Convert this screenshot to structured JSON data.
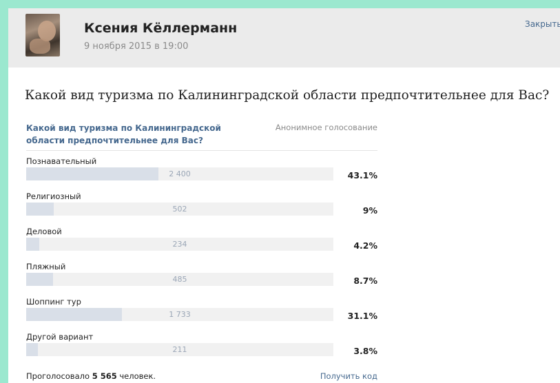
{
  "post": {
    "author": "Ксения Кёллерманн",
    "date": "9 ноября 2015 в 19:00",
    "close_label": "Закрыть",
    "question": "Какой вид туризма по Калининградской области предпочтительнее для Вас?"
  },
  "poll": {
    "title": "Какой вид туризма по Калининградской области предпочтительнее для Вас?",
    "type_label": "Анонимное голосование",
    "options": [
      {
        "label": "Познавательный",
        "votes": "2 400",
        "percent": "43.1%",
        "share": 0.431
      },
      {
        "label": "Религиозный",
        "votes": "502",
        "percent": "9%",
        "share": 0.09
      },
      {
        "label": "Деловой",
        "votes": "234",
        "percent": "4.2%",
        "share": 0.042
      },
      {
        "label": "Пляжный",
        "votes": "485",
        "percent": "8.7%",
        "share": 0.087
      },
      {
        "label": "Шоппинг тур",
        "votes": "1 733",
        "percent": "31.1%",
        "share": 0.311
      },
      {
        "label": "Другой вариант",
        "votes": "211",
        "percent": "3.8%",
        "share": 0.038
      }
    ],
    "total_prefix": "Проголосовало",
    "total_votes": "5 565",
    "total_suffix": "человек.",
    "get_code_label": "Получить код"
  },
  "colors": {
    "accent": "#45688e",
    "bar_fill": "#d9dfe8",
    "background": "#9be8cf"
  }
}
